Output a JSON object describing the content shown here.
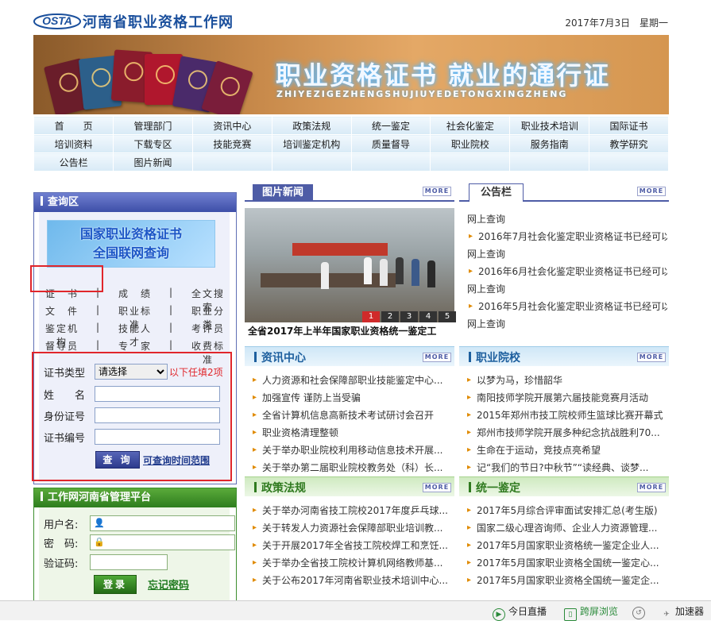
{
  "header": {
    "logo_text": "OSTA",
    "site_name": "河南省职业资格工作网",
    "date": "2017年7月3日",
    "weekday": "星期一"
  },
  "banner": {
    "title": "职业资格证书  就业的通行证",
    "pinyin": "ZHIYEZIGEZHENGSHUJIUYEDETONGXINGZHENG"
  },
  "nav": {
    "rows": [
      [
        "首　　页",
        "管理部门",
        "资讯中心",
        "政策法规",
        "统一鉴定",
        "社会化鉴定",
        "职业技术培训",
        "国际证书"
      ],
      [
        "培训资料",
        "下载专区",
        "技能竞赛",
        "培训鉴定机构",
        "质量督导",
        "职业院校",
        "服务指南",
        "教学研究"
      ],
      [
        "公告栏",
        "图片新闻",
        "",
        "",
        "",
        "",
        "",
        ""
      ]
    ]
  },
  "query": {
    "title": "查询区",
    "banner_line1": "国家职业资格证书",
    "banner_line2": "全国联网查询",
    "links": [
      [
        "证　书",
        "成　绩",
        "全文搜索"
      ],
      [
        "文　件",
        "职业标准",
        "职业分类"
      ],
      [
        "鉴定机构",
        "技能人才",
        "考评员"
      ],
      [
        "督导员",
        "专　家",
        "收费标准"
      ]
    ],
    "cert_type_label": "证书类型",
    "cert_type_value": "请选择",
    "hint": "以下任填2项",
    "name_label": "姓　　名",
    "id_label": "身份证号",
    "cert_no_label": "证书编号",
    "submit": "查 询",
    "range_link": "可查询时间范围"
  },
  "login": {
    "title": "工作网河南省管理平台",
    "user_label": "用户名:",
    "pass_label": "密　码:",
    "code_label": "验证码:",
    "submit": "登录",
    "forgot": "忘记密码"
  },
  "photo_news": {
    "title": "图片新闻",
    "more": "MORE",
    "caption": "全省2017年上半年国家职业资格统一鉴定工",
    "pages": [
      "1",
      "2",
      "3",
      "4",
      "5"
    ]
  },
  "notice": {
    "title": "公告栏",
    "more": "MORE",
    "items": [
      {
        "text": "网上查询",
        "bullet": false
      },
      {
        "text": "2016年7月社会化鉴定职业资格证书已经可以",
        "bullet": true
      },
      {
        "text": "网上查询",
        "bullet": false
      },
      {
        "text": "2016年6月社会化鉴定职业资格证书已经可以",
        "bullet": true
      },
      {
        "text": "网上查询",
        "bullet": false
      },
      {
        "text": "2016年5月社会化鉴定职业资格证书已经可以",
        "bullet": true
      },
      {
        "text": "网上查询",
        "bullet": false
      }
    ]
  },
  "news": {
    "title": "资讯中心",
    "more": "MORE",
    "items": [
      "人力资源和社会保障部职业技能鉴定中心...",
      "加强宣传 谨防上当受骗",
      "全省计算机信息高新技术考试研讨会召开",
      "职业资格清理整顿",
      "关于举办职业院校利用移动信息技术开展...",
      "关于举办第二届职业院校教务处（科）长..."
    ]
  },
  "schools": {
    "title": "职业院校",
    "more": "MORE",
    "items": [
      "以梦为马，珍惜韶华",
      "南阳技师学院开展第六届技能竞赛月活动",
      "2015年郑州市技工院校师生篮球比赛开幕式",
      "郑州市技师学院开展多种纪念抗战胜利70...",
      "生命在于运动，竞技点亮希望",
      "记“我们的节日?中秋节”“读经典、谈梦..."
    ]
  },
  "policy": {
    "title": "政策法规",
    "more": "MORE",
    "items": [
      "关于举办河南省技工院校2017年度乒乓球...",
      "关于转发人力资源社会保障部职业培训教...",
      "关于开展2017年全省技工院校焊工和烹饪...",
      "关于举办全省技工院校计算机网络教师基...",
      "关于公布2017年河南省职业技术培训中心..."
    ]
  },
  "appraisal": {
    "title": "统一鉴定",
    "more": "MORE",
    "items": [
      "2017年5月综合评审面试安排汇总(考生版)",
      "国家二级心理咨询师、企业人力资源管理...",
      "2017年5月国家职业资格统一鉴定企业人...",
      "2017年5月国家职业资格全国统一鉴定心...",
      "2017年5月国家职业资格全国统一鉴定企..."
    ]
  },
  "statusbar": {
    "live": "今日直播",
    "split": "跨屏浏览",
    "speed": "加速器"
  }
}
